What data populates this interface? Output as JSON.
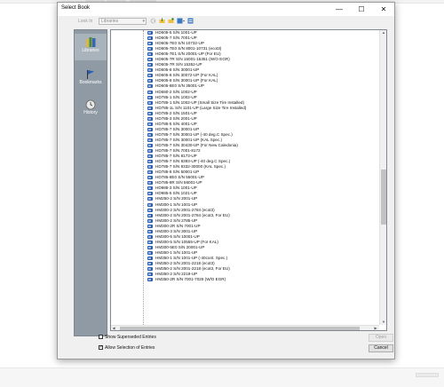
{
  "dialog": {
    "title": "Select Book",
    "minimize_glyph": "—",
    "maximize_glyph": "☐",
    "close_glyph": "✕"
  },
  "lookin": {
    "label": "Look In",
    "value": "Libraries"
  },
  "sidebar": {
    "items": [
      {
        "label": "Libraries",
        "icon": "books-icon"
      },
      {
        "label": "Bookmarks",
        "icon": "flag-icon"
      },
      {
        "label": "History",
        "icon": "clock-icon"
      }
    ]
  },
  "list": {
    "rows": [
      "HD605-5 S/N 1001-UP",
      "HD605-7 S/N 7001-UP",
      "HD605-7E0 S/N 10732-UP",
      "HD605-7E0 S/N 8001-10731 (ecot3)",
      "HD605-7E1 S/N 20001-UP (For EU)",
      "HD605-7R S/N 15001-15351 (W/O EGR)",
      "HD605-7R S/N 15352-UP",
      "HD605-8 S/N 30001-UP",
      "HD605-8 S/N 30072-UP (For KAL)",
      "HD605-8 S/N 30001-UP (For KAL)",
      "HD605-8E0 S/N 35001-UP",
      "HD680-2 S/N 1002-UP",
      "HD785-1 S/N 1002-UP",
      "HD785-1 S/N 1002-UP (Small Size Tire Installed)",
      "HD785-1L S/N 1101-UP (Large Size Tire Installed)",
      "HD785-2 S/N 1501-UP",
      "HD785-3 S/N 2001-UP",
      "HD785-5 S/N 4001-UP",
      "HD785-7 S/N 30001-UP",
      "HD785-7 S/N 30001-UP (-40 deg.C Spec.)",
      "HD785-7 S/N 30001-UP (KAL Spec.)",
      "HD785-7 S/N 30430-UP (For New Caledonia)",
      "HD785-7 S/N 7001-8172",
      "HD785-7 S/N 8173-UP",
      "HD785-7 S/N 8393-UP (-40 deg.C Spec.)",
      "HD785-7 S/N 8332-30000 (KAL Spec.)",
      "HD785-8 S/N 50001-UP",
      "HD785-8E0 S/N 55001-UP",
      "HD785-8R S/N 58001-UP",
      "HD985-3 S/N 1001-UP",
      "HD985-5 S/N 1021-UP",
      "HM250-2 S/N 2001-UP",
      "HM300-1 S/N 1001-UP",
      "HM300-2 S/N 2001-2784 (ecot3)",
      "HM300-2 S/N 2001-2784 (ecot3, For EU)",
      "HM300-2 S/N 2785-UP",
      "HM300-2R S/N 7001-UP",
      "HM300-3 S/N 3001-UP",
      "HM300-5 S/N 10001-UP",
      "HM300-5 S/N 10555-UP (For KAL)",
      "HM300-5E0 S/N 20001-UP",
      "HM350-1 S/N 1001-UP",
      "HM350-1 S/N 1001-UP (-40cont. Spec.)",
      "HM350-2 S/N 2001-2218 (ecot3)",
      "HM350-2 S/N 2001-2218 (ecot3, For EU)",
      "HM350-2 S/N 2219-UP",
      "HM350-2R S/N 7001-7026 (W/O EGR)"
    ]
  },
  "options": {
    "show_superseded": {
      "label": "Show Superseded Entries",
      "checked": false
    },
    "allow_selection": {
      "label": "Allow Selection of Entries",
      "checked": true
    }
  },
  "buttons": {
    "open": "Open",
    "cancel": "Cancel"
  },
  "colors": {
    "sidebar_bg": "#8f9aa4",
    "book_icon": "#2d5fa8"
  }
}
